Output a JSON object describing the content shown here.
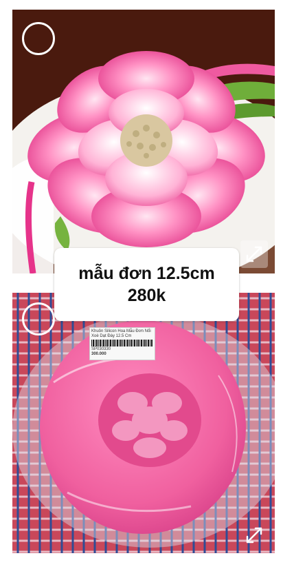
{
  "caption": {
    "line1": "mẫu đơn 12.5cm",
    "line2": "280k"
  },
  "photos": [
    {
      "subject": "pink peony jelly flower on white cake",
      "icon": "expand-icon"
    },
    {
      "subject": "pink silicone peony mold in plastic bag",
      "icon": "expand-icon"
    }
  ],
  "price_tag": {
    "text": "Khuôn Silicon Hoa Mẫu Đơn Nổi Xoè Dạt Đáy 12.5 Cm",
    "sku": "SP030330",
    "price": "300.000"
  },
  "colors": {
    "accent": "#ec4f98",
    "mold": "#f0609f",
    "overlay_white": "#ffffff"
  }
}
